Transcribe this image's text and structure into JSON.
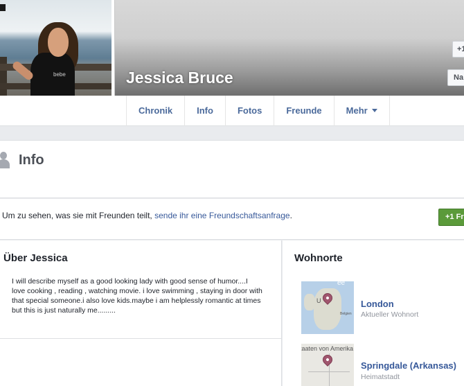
{
  "profile": {
    "name": "Jessica Bruce",
    "shirt_text": "bebe"
  },
  "header_buttons": {
    "button_a_label": "+1",
    "button_b_label": "Na"
  },
  "nav": {
    "tabs": [
      {
        "label": "Chronik"
      },
      {
        "label": "Info"
      },
      {
        "label": "Fotos"
      },
      {
        "label": "Freunde"
      },
      {
        "label": "Mehr"
      }
    ]
  },
  "info_section": {
    "title": "Info"
  },
  "friend_request": {
    "text": "Um zu sehen, was sie mit Freunden teilt, ",
    "link": "sende ihr eine Freundschaftsanfrage",
    "suffix": ".",
    "button_label": "+1 Fr"
  },
  "about": {
    "title": "Über Jessica",
    "text": "I will describe myself as a good looking lady with good sense of humor....I love cooking , reading , watching movie. i love swimming , staying in door with that special someone.i also love kids.maybe i am helplessly romantic at times but this is just naturally me........."
  },
  "places": {
    "title": "Wohnorte",
    "items": [
      {
        "name": "London",
        "subtitle": "Aktueller Wohnort",
        "map_labels": [
          "U",
          "ee",
          "Belgien"
        ]
      },
      {
        "name": "Springdale (Arkansas)",
        "subtitle": "Heimatstadt",
        "map_labels": [
          "taaten von Amerika"
        ]
      }
    ]
  },
  "colors": {
    "link": "#365899",
    "tab_text": "#4b6a9b",
    "add_friend_green": "#5b9a3a",
    "pin": "#a0566e"
  }
}
